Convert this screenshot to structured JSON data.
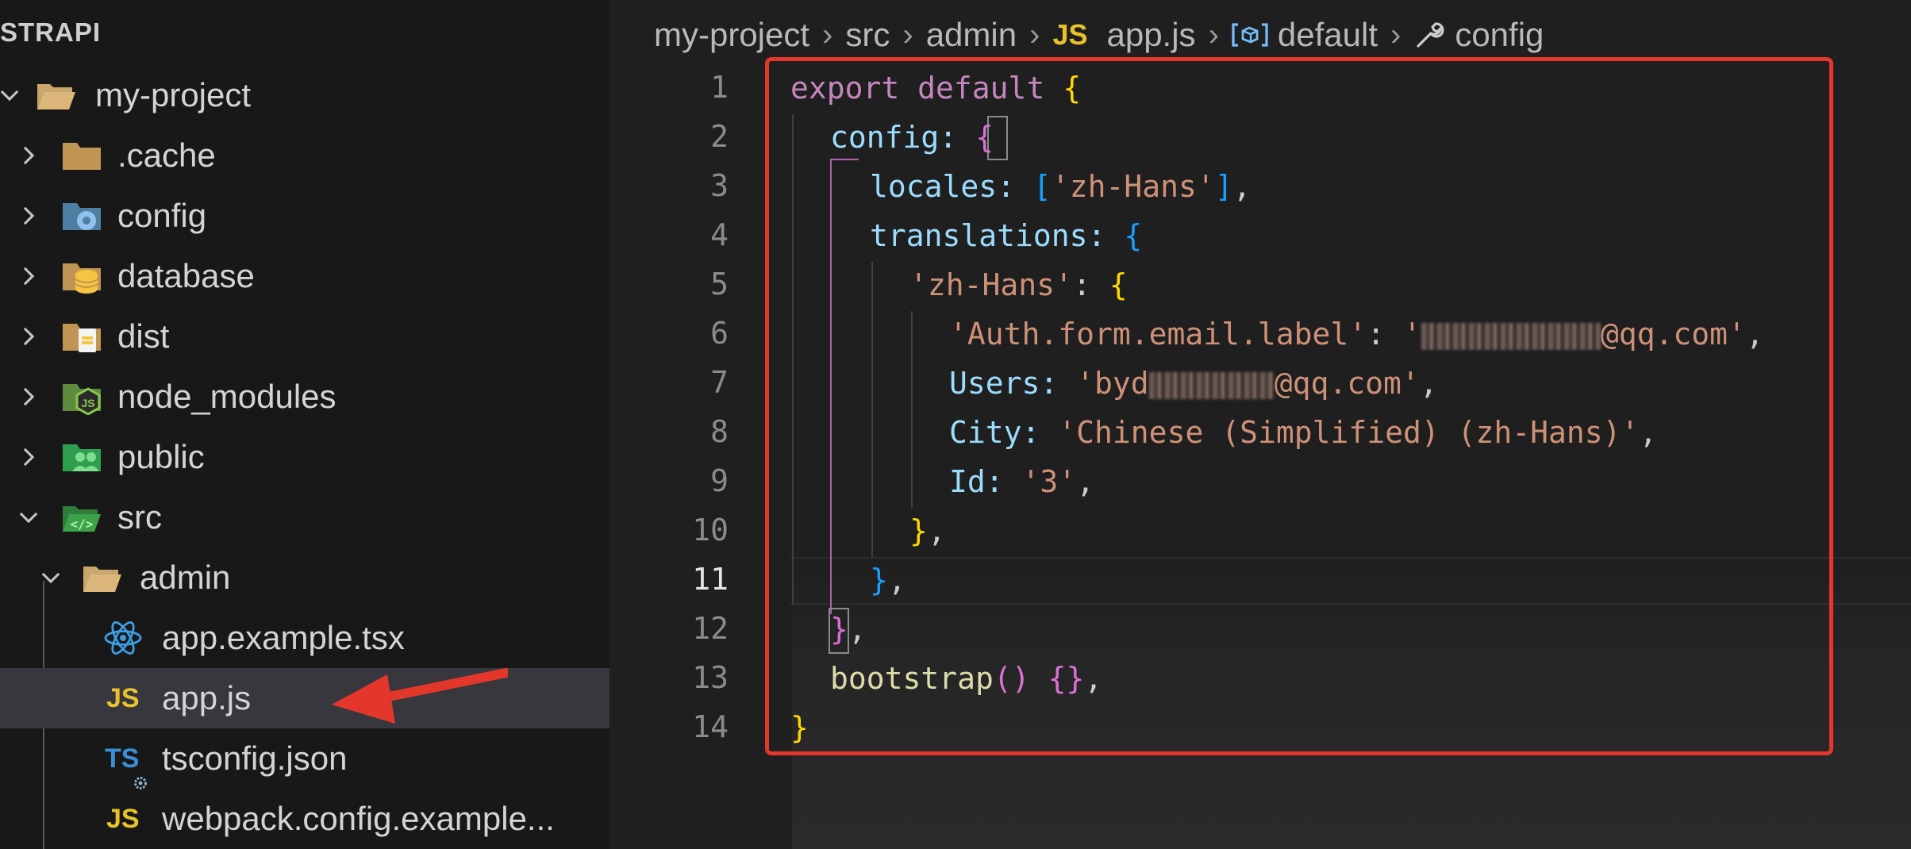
{
  "sidebar": {
    "title": "STRAPI",
    "items": [
      {
        "label": "my-project",
        "icon": "folder-open-icon",
        "expanded": true
      },
      {
        "label": ".cache",
        "icon": "folder-icon",
        "expanded": false
      },
      {
        "label": "config",
        "icon": "config-folder-icon",
        "expanded": false
      },
      {
        "label": "database",
        "icon": "database-folder-icon",
        "expanded": false
      },
      {
        "label": "dist",
        "icon": "dist-folder-icon",
        "expanded": false
      },
      {
        "label": "node_modules",
        "icon": "node-modules-folder-icon",
        "expanded": false
      },
      {
        "label": "public",
        "icon": "public-folder-icon",
        "expanded": false
      },
      {
        "label": "src",
        "icon": "src-folder-icon",
        "expanded": true
      },
      {
        "label": "admin",
        "icon": "folder-open-icon",
        "expanded": true
      },
      {
        "label": "app.example.tsx",
        "icon": "react-icon"
      },
      {
        "label": "app.js",
        "icon": "js-file-icon",
        "selected": true
      },
      {
        "label": "tsconfig.json",
        "icon": "ts-config-icon"
      },
      {
        "label": "webpack.config.example...",
        "icon": "js-file-icon"
      }
    ],
    "badges": {
      "js": "JS",
      "ts": "TS"
    }
  },
  "breadcrumbs": {
    "items": [
      "my-project",
      "src",
      "admin",
      "app.js",
      "default",
      "config"
    ],
    "js_badge": "JS"
  },
  "editor": {
    "line_numbers": [
      "1",
      "2",
      "3",
      "4",
      "5",
      "6",
      "7",
      "8",
      "9",
      "10",
      "11",
      "12",
      "13",
      "14"
    ],
    "active_line": "11",
    "code": {
      "l1_export": "export",
      "l1_default": "default",
      "l1_brace": "{",
      "l2_key": "config",
      "l2_colon": ":",
      "l2_brace": "{",
      "l3_key": "locales",
      "l3_colon": ":",
      "l3_open": "[",
      "l3_val": "'zh-Hans'",
      "l3_close": "]",
      "l3_comma": ",",
      "l4_key": "translations",
      "l4_colon": ":",
      "l4_brace": "{",
      "l5_key": "'zh-Hans'",
      "l5_colon": ":",
      "l5_brace": "{",
      "l6_key": "'Auth.form.email.label'",
      "l6_colon": ":",
      "l6_val_start": "'",
      "l6_val_end": "@qq.com'",
      "l6_comma": ",",
      "l7_key": "Users",
      "l7_colon": ":",
      "l7_val_start": "'byd",
      "l7_val_end": "@qq.com'",
      "l7_comma": ",",
      "l8_key": "City",
      "l8_colon": ":",
      "l8_val": "'Chinese (Simplified) (zh-Hans)'",
      "l8_comma": ",",
      "l9_key": "Id",
      "l9_colon": ":",
      "l9_val": "'3'",
      "l9_comma": ",",
      "l10_brace": "}",
      "l10_comma": ",",
      "l11_brace": "}",
      "l11_comma": ",",
      "l12_brace": "}",
      "l12_comma": ",",
      "l13_fn": "bootstrap",
      "l13_parens": "()",
      "l13_braces": "{}",
      "l13_comma": ",",
      "l14_brace": "}"
    }
  },
  "colors": {
    "highlight_box": "#e3372c",
    "arrow": "#e3372c",
    "js_badge": "#e8c22c"
  }
}
